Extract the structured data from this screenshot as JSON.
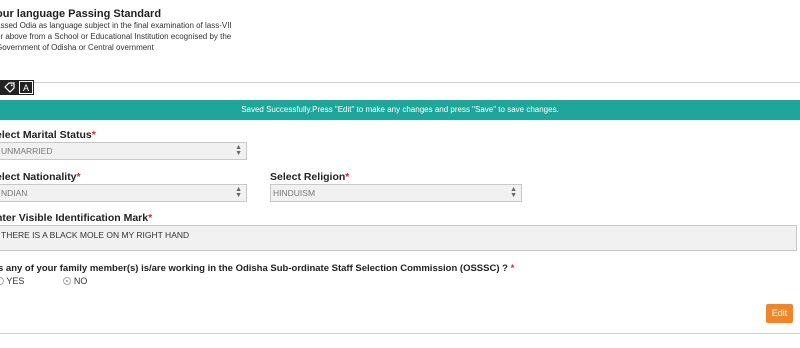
{
  "language": {
    "title": "our language Passing Standard",
    "description": "assed Odia as language subject in the final examination of lass-VII or above from a School or Educational Institution ecognised by the Government of Odisha or Central overnment"
  },
  "toolbar": {
    "tag_icon": "tag-icon",
    "font_icon": "A"
  },
  "alert": {
    "message": "Saved Successfully.Press \"Edit\" to make any changes and press \"Save\" to save changes."
  },
  "form": {
    "marital": {
      "label": "elect Marital Status",
      "required": "*",
      "value": "UNMARRIED"
    },
    "nationality": {
      "label": "elect Nationality",
      "required": "*",
      "value": "NDIAN"
    },
    "religion": {
      "label": "Select Religion",
      "required": "*",
      "value": "HINDUISM"
    },
    "identification": {
      "label": "nter Visible Identification Mark",
      "required": "*",
      "value": "THERE IS A BLACK MOLE ON MY RIGHT HAND"
    },
    "family": {
      "question": "s any of your family member(s) is/are working in the Odisha Sub-ordinate Staff Selection Commission (OSSSC) ?",
      "required": "*",
      "options": [
        "YES",
        "NO"
      ],
      "selected": "NO"
    }
  },
  "actions": {
    "edit_label": "Edit"
  },
  "colors": {
    "alert_bg": "#1ea69a",
    "edit_bg": "#f0862b",
    "required": "#d9252a"
  }
}
